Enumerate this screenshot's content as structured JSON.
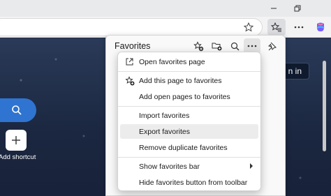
{
  "window": {
    "controls": [
      "minimize-icon",
      "restore-icon"
    ]
  },
  "toolbar": {
    "icons": [
      "star-icon",
      "favorites-icon",
      "more-icon",
      "copilot-icon"
    ]
  },
  "page": {
    "signin_label": "n in",
    "shortcut_label": "Add shortcut"
  },
  "favorites": {
    "title": "Favorites",
    "header_icons": [
      "add-favorite-icon",
      "add-folder-icon",
      "search-icon",
      "more-icon",
      "pin-icon"
    ],
    "menu": {
      "items": [
        {
          "label": "Open favorites page",
          "icon": "open-external-icon"
        },
        {
          "label": "Add this page to favorites",
          "icon": "add-favorite-icon"
        },
        {
          "label": "Add open pages to favorites",
          "icon": ""
        },
        {
          "label": "Import favorites",
          "icon": ""
        },
        {
          "label": "Export favorites",
          "icon": ""
        },
        {
          "label": "Remove duplicate favorites",
          "icon": ""
        },
        {
          "label": "Show favorites bar",
          "icon": ""
        },
        {
          "label": "Hide favorites button from toolbar",
          "icon": ""
        }
      ],
      "highlighted": "Export favorites"
    }
  },
  "colors": {
    "accent_blue": "#2f74d0",
    "page_bg": "#1f2c45",
    "panel_bg": "#f9f9f9",
    "menu_highlight": "#ececec"
  }
}
